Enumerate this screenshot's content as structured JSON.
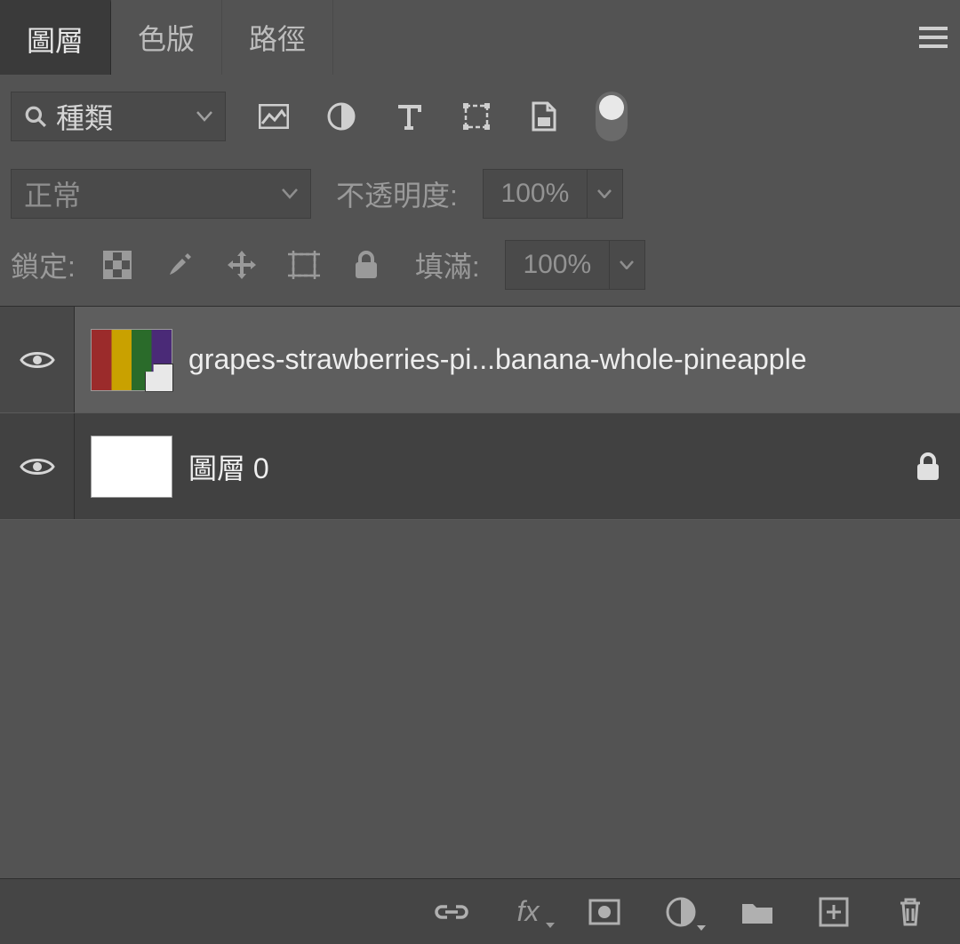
{
  "tabs": {
    "layers": "圖層",
    "channels": "色版",
    "paths": "路徑"
  },
  "filter": {
    "label": "種類"
  },
  "blend": {
    "mode": "正常",
    "opacity_label": "不透明度:",
    "opacity_value": "100%"
  },
  "lock": {
    "label": "鎖定:",
    "fill_label": "填滿:",
    "fill_value": "100%"
  },
  "layers": [
    {
      "name": "grapes-strawberries-pi...banana-whole-pineapple",
      "visible": true,
      "locked": false,
      "smart": true,
      "selected": true,
      "thumb": "fruit"
    },
    {
      "name": "圖層 0",
      "visible": true,
      "locked": true,
      "smart": false,
      "selected": false,
      "thumb": "white"
    }
  ]
}
